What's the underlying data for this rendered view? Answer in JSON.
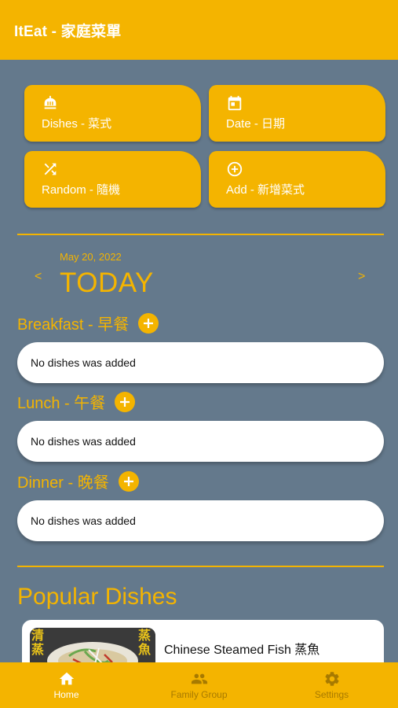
{
  "appbar": {
    "title": "ItEat - 家庭菜單"
  },
  "tiles": [
    {
      "label": "Dishes - 菜式",
      "icon": "restaurant-icon"
    },
    {
      "label": "Date - 日期",
      "icon": "calendar-icon"
    },
    {
      "label": "Random - 隨機",
      "icon": "shuffle-icon"
    },
    {
      "label": "Add - 新增菜式",
      "icon": "add-circle-icon"
    }
  ],
  "date_nav": {
    "date": "May 20, 2022",
    "heading": "TODAY",
    "prev": "<",
    "next": ">"
  },
  "meals": [
    {
      "title": "Breakfast - 早餐",
      "empty_text": "No dishes was added"
    },
    {
      "title": "Lunch - 午餐",
      "empty_text": "No dishes was added"
    },
    {
      "title": "Dinner - 晚餐",
      "empty_text": "No dishes was added"
    }
  ],
  "popular": {
    "title": "Popular Dishes",
    "dishes": [
      {
        "name": "Chinese Steamed Fish 蒸魚",
        "image_text": [
          "清蒸",
          "蒸魚"
        ]
      }
    ]
  },
  "bottom_nav": [
    {
      "label": "Home",
      "icon": "home-icon",
      "active": true
    },
    {
      "label": "Family Group",
      "icon": "people-icon",
      "active": false
    },
    {
      "label": "Settings",
      "icon": "gear-icon",
      "active": false
    }
  ],
  "colors": {
    "accent": "#f4b400",
    "background": "#64798c",
    "card": "#ffffff"
  }
}
